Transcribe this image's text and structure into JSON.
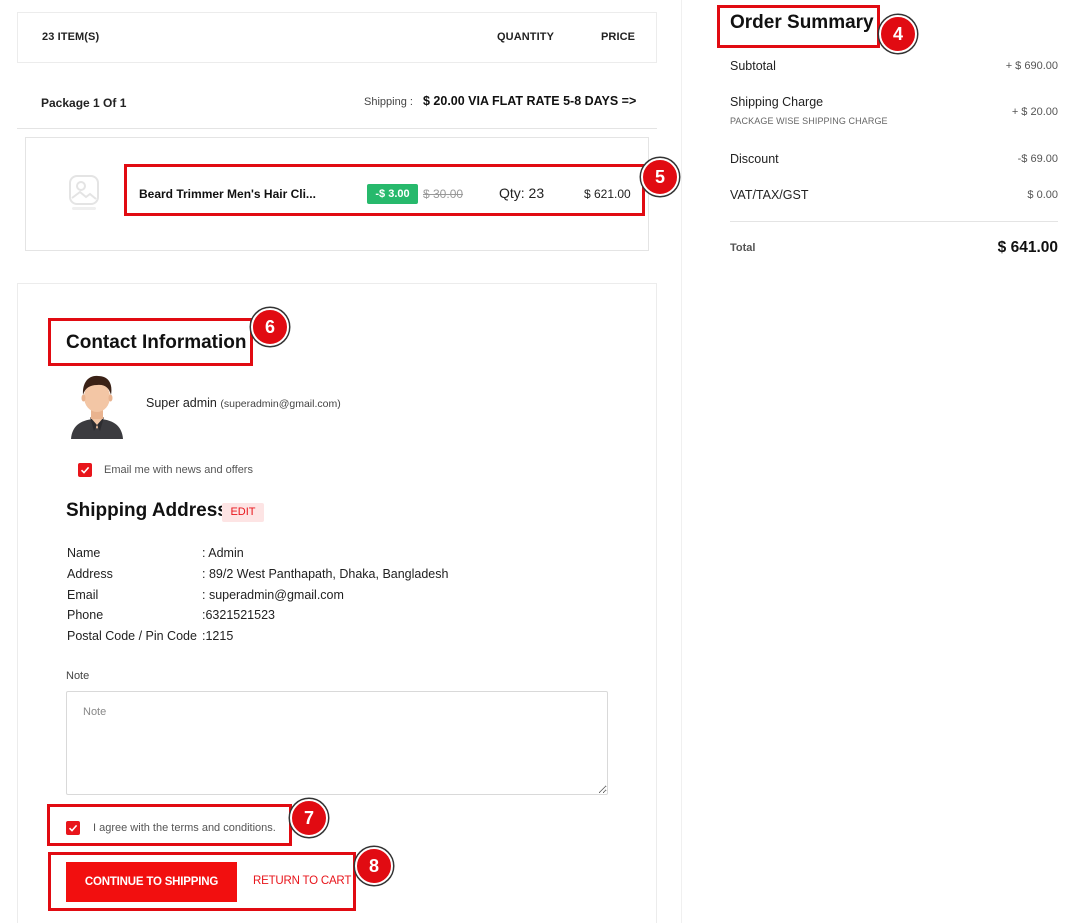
{
  "cart_header": {
    "items_count": "23 ITEM(S)",
    "quantity_col": "QUANTITY",
    "price_col": "PRICE"
  },
  "package": {
    "label": "Package 1 Of 1",
    "shipping_label": "Shipping :",
    "shipping_value": "$ 20.00 VIA FLAT RATE 5-8 DAYS =>"
  },
  "product": {
    "name": "Beard Trimmer Men's Hair Cli...",
    "discount": "-$ 3.00",
    "old_price": "$ 30.00",
    "qty": "Qty: 23",
    "line_price": "$ 621.00",
    "thumb_icon": "image-placeholder-icon"
  },
  "contact": {
    "title": "Contact Information",
    "user_name": "Super admin",
    "user_email": "(superadmin@gmail.com)",
    "newsletter_label": "Email me with news and offers"
  },
  "shipping_address": {
    "title": "Shipping Address",
    "edit_label": "EDIT",
    "rows": [
      {
        "label": "Name",
        "value": ": Admin"
      },
      {
        "label": "Address",
        "value": ": 89/2 West Panthapath, Dhaka, Bangladesh"
      },
      {
        "label": "Email",
        "value": ": superadmin@gmail.com"
      },
      {
        "label": "Phone",
        "value": ":6321521523"
      },
      {
        "label": "Postal Code / Pin Code",
        "value": ":1215"
      }
    ]
  },
  "note": {
    "label": "Note",
    "placeholder": "Note",
    "value": ""
  },
  "terms": {
    "label": "I agree with the terms and conditions."
  },
  "actions": {
    "continue_label": "CONTINUE TO SHIPPING",
    "return_label": "RETURN TO CART"
  },
  "order_summary": {
    "title": "Order Summary",
    "subtotal_label": "Subtotal",
    "subtotal_value": "+ $ 690.00",
    "shipping_label": "Shipping Charge",
    "shipping_sub": "PACKAGE WISE SHIPPING CHARGE",
    "shipping_value": "+ $ 20.00",
    "discount_label": "Discount",
    "discount_value": "-$ 69.00",
    "vat_label": "VAT/TAX/GST",
    "vat_value": "$ 0.00",
    "total_label": "Total",
    "total_value": "$ 641.00"
  },
  "annotations": [
    "4",
    "5",
    "6",
    "7",
    "8"
  ],
  "colors": {
    "accent": "#e8151b",
    "button": "#f20f0f",
    "discount_badge": "#27b96c",
    "annotation": "#e10b12"
  }
}
